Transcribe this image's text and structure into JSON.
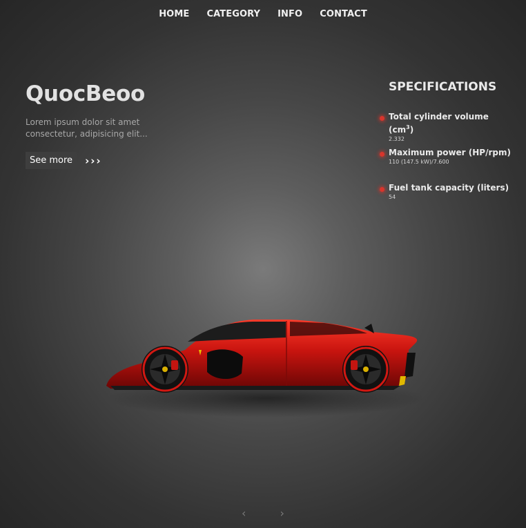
{
  "nav": {
    "items": [
      {
        "label": "HOME"
      },
      {
        "label": "CATEGORY"
      },
      {
        "label": "INFO"
      },
      {
        "label": "CONTACT"
      }
    ]
  },
  "hero": {
    "title": "QuocBeoo",
    "description": "Lorem ipsum dolor sit amet consectetur, adipisicing elit...",
    "see_more_label": "See more",
    "see_more_arrows": "›››"
  },
  "specifications": {
    "heading": "SPECIFICATIONS",
    "items": [
      {
        "title": "Total cylinder volume (cm",
        "sup": "3",
        "title_end": ")",
        "value": "2.332"
      },
      {
        "title": "Maximum power (HP/rpm)",
        "value": "110 (147.5 kW)/7.600"
      },
      {
        "title": "Fuel tank capacity (liters)",
        "value": "54"
      }
    ]
  },
  "pager": {
    "prev_icon": "‹",
    "next_icon": "›"
  },
  "colors": {
    "accent_dot": "#d8352c",
    "car_red": "#c8140f"
  }
}
